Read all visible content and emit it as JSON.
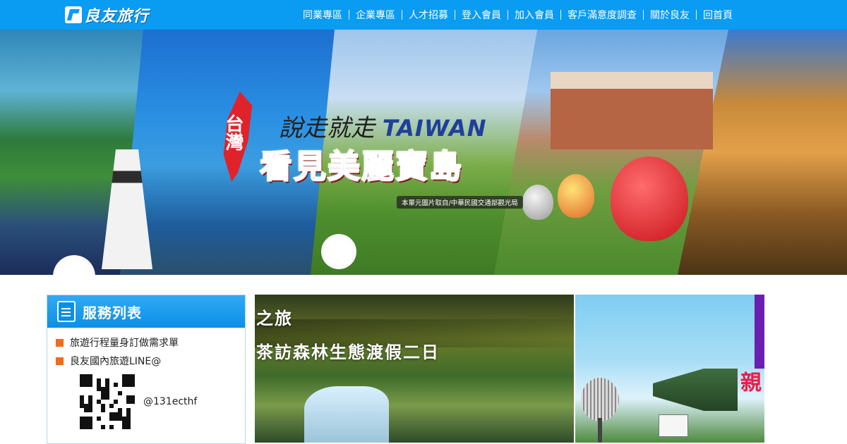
{
  "header": {
    "logo_text": "良友旅行",
    "nav": [
      "同業專區",
      "企業專區",
      "人才招募",
      "登入會員",
      "加入會員",
      "客戶滿意度調查",
      "關於良友",
      "回首頁"
    ]
  },
  "banner": {
    "taiwan_label": "台灣",
    "slogan_cn": "說走就走",
    "slogan_en": "TAIWAN",
    "title": "看見美麗寶島",
    "credit": "本單元圖片取自/中華民國交通部觀光局"
  },
  "sidebar": {
    "title": "服務列表",
    "items": [
      "旅遊行程量身訂做需求單",
      "良友國內旅遊LINE@"
    ],
    "line_id": "@131ecthf"
  },
  "cards": {
    "c1_line1": "之旅",
    "c1_line2": "茶訪森林生態渡假二日",
    "c2_text": "親"
  },
  "colors": {
    "brand_blue": "#0a9bf2",
    "bullet_orange": "#f26a1b",
    "title_red": "#e3202a"
  }
}
